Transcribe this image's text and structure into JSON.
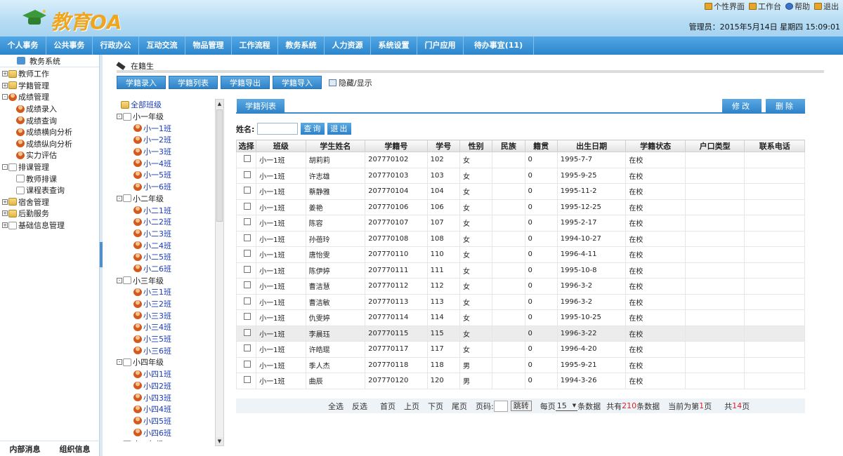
{
  "header": {
    "logo_text": "教育OA",
    "top_links": [
      "个性界面",
      "工作台",
      "帮助",
      "退出"
    ],
    "admin_info": "管理员：2015年5月14日 星期四 15:09:01"
  },
  "nav": {
    "items": [
      "个人事务",
      "公共事务",
      "行政办公",
      "互动交流",
      "物品管理",
      "工作流程",
      "教务系统",
      "人力资源",
      "系统设置",
      "门户应用",
      "待办事宜(11)"
    ]
  },
  "sidebar": {
    "title": "教务系统",
    "tree": [
      {
        "label": "教师工作",
        "level": 0,
        "pm": "+",
        "icon": "folder"
      },
      {
        "label": "学籍管理",
        "level": 0,
        "pm": "+",
        "icon": "folder"
      },
      {
        "label": "成绩管理",
        "level": 0,
        "pm": "-",
        "icon": "person"
      },
      {
        "label": "成绩录入",
        "level": 1,
        "pm": "",
        "icon": "person"
      },
      {
        "label": "成绩查询",
        "level": 1,
        "pm": "",
        "icon": "person"
      },
      {
        "label": "成绩横向分析",
        "level": 1,
        "pm": "",
        "icon": "person"
      },
      {
        "label": "成绩纵向分析",
        "level": 1,
        "pm": "",
        "icon": "person"
      },
      {
        "label": "实力评估",
        "level": 1,
        "pm": "",
        "icon": "person"
      },
      {
        "label": "排课管理",
        "level": 0,
        "pm": "-",
        "icon": "page"
      },
      {
        "label": "教师排课",
        "level": 1,
        "pm": "",
        "icon": "page"
      },
      {
        "label": "课程表查询",
        "level": 1,
        "pm": "",
        "icon": "page"
      },
      {
        "label": "宿舍管理",
        "level": 0,
        "pm": "+",
        "icon": "folder"
      },
      {
        "label": "后勤服务",
        "level": 0,
        "pm": "+",
        "icon": "folder"
      },
      {
        "label": "基础信息管理",
        "level": 0,
        "pm": "+",
        "icon": "page"
      }
    ],
    "bottom": [
      "内部消息",
      "组织信息"
    ]
  },
  "breadcrumb": "在籍生",
  "tabs": [
    "学籍录入",
    "学籍列表",
    "学籍导出",
    "学籍导入"
  ],
  "toggle_label": "隐藏/显示",
  "class_tree": {
    "root": "全部班级",
    "grades": [
      {
        "name": "小一年级",
        "classes": [
          "小一1班",
          "小一2班",
          "小一3班",
          "小一4班",
          "小一5班",
          "小一6班"
        ]
      },
      {
        "name": "小二年级",
        "classes": [
          "小二1班",
          "小二2班",
          "小二3班",
          "小二4班",
          "小二5班",
          "小二6班"
        ]
      },
      {
        "name": "小三年级",
        "classes": [
          "小三1班",
          "小三2班",
          "小三3班",
          "小三4班",
          "小三5班",
          "小三6班"
        ]
      },
      {
        "name": "小四年级",
        "classes": [
          "小四1班",
          "小四2班",
          "小四3班",
          "小四4班",
          "小四5班",
          "小四6班"
        ]
      },
      {
        "name": "小五年级",
        "classes": []
      }
    ]
  },
  "panel": {
    "tab": "学籍列表",
    "edit": "修改",
    "delete": "删除",
    "search_label": "姓名:",
    "search_btn": "查询",
    "exit_btn": "退出"
  },
  "table": {
    "headers": [
      "选择",
      "班级",
      "学生姓名",
      "学籍号",
      "学号",
      "性别",
      "民族",
      "籍贯",
      "出生日期",
      "学籍状态",
      "户口类型",
      "联系电话"
    ],
    "rows": [
      [
        "小一1班",
        "胡莉莉",
        "207770102",
        "102",
        "女",
        "",
        "0",
        "1995-7-7",
        "在校",
        "",
        ""
      ],
      [
        "小一1班",
        "许志雄",
        "207770103",
        "103",
        "女",
        "",
        "0",
        "1995-9-25",
        "在校",
        "",
        ""
      ],
      [
        "小一1班",
        "蔡静雅",
        "207770104",
        "104",
        "女",
        "",
        "0",
        "1995-11-2",
        "在校",
        "",
        ""
      ],
      [
        "小一1班",
        "姜艳",
        "207770106",
        "106",
        "女",
        "",
        "0",
        "1995-12-25",
        "在校",
        "",
        ""
      ],
      [
        "小一1班",
        "陈容",
        "207770107",
        "107",
        "女",
        "",
        "0",
        "1995-2-17",
        "在校",
        "",
        ""
      ],
      [
        "小一1班",
        "孙蓓玲",
        "207770108",
        "108",
        "女",
        "",
        "0",
        "1994-10-27",
        "在校",
        "",
        ""
      ],
      [
        "小一1班",
        "唐怡雯",
        "207770110",
        "110",
        "女",
        "",
        "0",
        "1996-4-11",
        "在校",
        "",
        ""
      ],
      [
        "小一1班",
        "陈伊婷",
        "207770111",
        "111",
        "女",
        "",
        "0",
        "1995-10-8",
        "在校",
        "",
        ""
      ],
      [
        "小一1班",
        "曹洁慧",
        "207770112",
        "112",
        "女",
        "",
        "0",
        "1996-3-2",
        "在校",
        "",
        ""
      ],
      [
        "小一1班",
        "曹洁敏",
        "207770113",
        "113",
        "女",
        "",
        "0",
        "1996-3-2",
        "在校",
        "",
        ""
      ],
      [
        "小一1班",
        "仇雯婷",
        "207770114",
        "114",
        "女",
        "",
        "0",
        "1995-10-25",
        "在校",
        "",
        ""
      ],
      [
        "小一1班",
        "李晨珏",
        "207770115",
        "115",
        "女",
        "",
        "0",
        "1996-3-22",
        "在校",
        "",
        ""
      ],
      [
        "小一1班",
        "许皓琨",
        "207770117",
        "117",
        "女",
        "",
        "0",
        "1996-4-20",
        "在校",
        "",
        ""
      ],
      [
        "小一1班",
        "季人杰",
        "207770118",
        "118",
        "男",
        "",
        "0",
        "1995-9-21",
        "在校",
        "",
        ""
      ],
      [
        "小一1班",
        "曲辰",
        "207770120",
        "120",
        "男",
        "",
        "0",
        "1994-3-26",
        "在校",
        "",
        ""
      ]
    ],
    "highlight_row": 11
  },
  "pager": {
    "select_all": "全选",
    "invert": "反选",
    "first": "首页",
    "prev": "上页",
    "next": "下页",
    "last": "尾页",
    "page_code": "页码:",
    "jump": "跳转",
    "per_page_prefix": "每页",
    "per_page": "15",
    "per_page_suffix": "条数据",
    "total_prefix": "共有",
    "total": "210",
    "total_suffix": "条数据",
    "current_prefix": "当前为第",
    "current": "1",
    "current_suffix": "页",
    "pages_prefix": "共",
    "pages": "14",
    "pages_suffix": "页"
  },
  "colors": {
    "accent": "#2f82c8",
    "header_bg": "#b5dcf4",
    "logo": "#f0a51e",
    "red": "#d9262c"
  }
}
